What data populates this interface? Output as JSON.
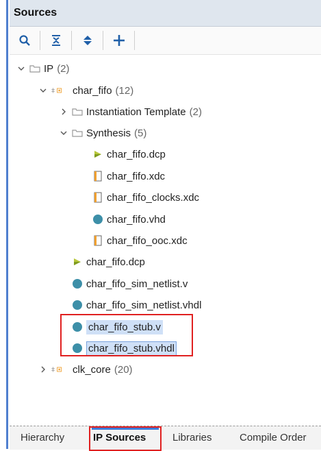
{
  "panel": {
    "title": "Sources"
  },
  "toolbar": {
    "buttons": [
      {
        "icon": "search-icon"
      },
      {
        "icon": "collapse-all-icon"
      },
      {
        "icon": "expand-all-icon"
      },
      {
        "icon": "add-icon"
      }
    ]
  },
  "tree": {
    "ip": {
      "label": "IP",
      "count": "(2)"
    },
    "char_fifo": {
      "label": "char_fifo",
      "count": "(12)"
    },
    "instantiation": {
      "label": "Instantiation Template",
      "count": "(2)"
    },
    "synthesis": {
      "label": "Synthesis",
      "count": "(5)"
    },
    "syn_files": [
      "char_fifo.dcp",
      "char_fifo.xdc",
      "char_fifo_clocks.xdc",
      "char_fifo.vhd",
      "char_fifo_ooc.xdc"
    ],
    "files": [
      "char_fifo.dcp",
      "char_fifo_sim_netlist.v",
      "char_fifo_sim_netlist.vhdl",
      "char_fifo_stub.v",
      "char_fifo_stub.vhdl"
    ],
    "clk_core": {
      "label": "clk_core",
      "count": "(20)"
    }
  },
  "tabs": [
    "Hierarchy",
    "IP Sources",
    "Libraries",
    "Compile Order"
  ],
  "colors": {
    "accent": "#3d7bd9",
    "highlight": "#e02020",
    "selection": "#cfe0f7",
    "ip_icon": "#f0a030",
    "hdl_icon": "#3d8fa8"
  }
}
